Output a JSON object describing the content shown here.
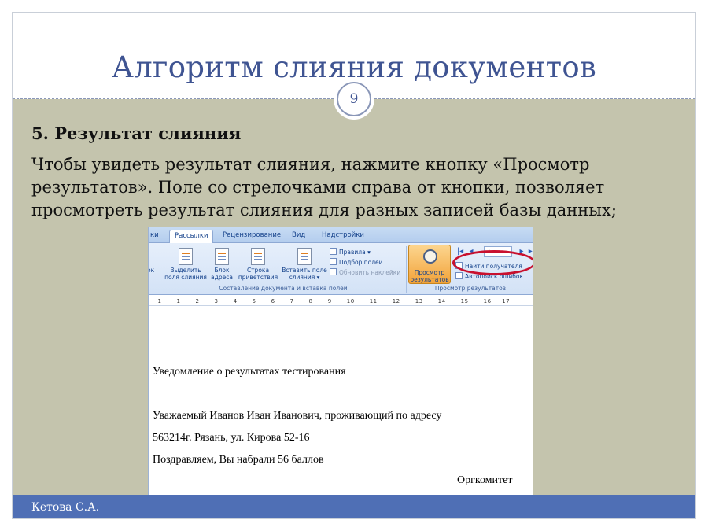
{
  "slide": {
    "title": "Алгоритм слияния документов",
    "page_number": "9",
    "section_heading": "5. Результат слияния",
    "body_text": "Чтобы увидеть результат слияния, нажмите кнопку «Просмотр результатов». Поле со стрелочками справа от кнопки, позволяет просмотреть результат слияния для разных записей базы данных;",
    "author": "Кетова С.А."
  },
  "word": {
    "tabs": [
      "Рассылки",
      "Рецензирование",
      "Вид",
      "Надстройки"
    ],
    "left_tab_fragment": "ки",
    "left_btn_fragment": "ок",
    "buttons": {
      "highlight": [
        "Выделить",
        "поля слияния"
      ],
      "address": [
        "Блок",
        "адреса"
      ],
      "greeting": [
        "Строка",
        "приветствия"
      ],
      "insert_field": [
        "Вставить поле",
        "слияния ▾"
      ],
      "rules": "Правила ▾",
      "match_fields": "Подбор полей",
      "update_labels": "Обновить наклейки",
      "preview": [
        "Просмотр",
        "результатов"
      ],
      "find_recipient": "Найти получателя",
      "auto_check": "Автопоиск ошибок"
    },
    "group_labels": {
      "compose": "Составление документа и вставка полей",
      "preview": "Просмотр результатов"
    },
    "record_number": "1",
    "ruler_text": "· 1 · · · 1 · · · 2 · · · 3 · · · 4 · · · 5 · · · 6 · · · 7 · · · 8 · · · 9 · · · 10 · · · 11 · · · 12 · · · 13 · · · 14 · · · 15 · · · 16 · · 17"
  },
  "document": {
    "line1": "Уведомление о результатах тестирования",
    "line2": "Уважаемый Иванов Иван Иванович, проживающий по адресу",
    "line3": "563214г. Рязань, ул. Кирова 52-16",
    "line4": "Поздравляем, Вы набрали 56 баллов",
    "signature": "Оргкомитет"
  }
}
